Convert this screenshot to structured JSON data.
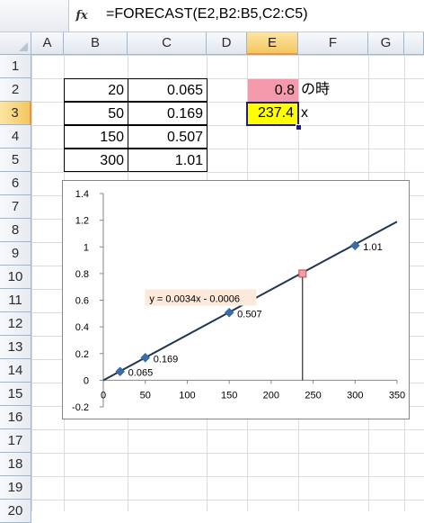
{
  "formula_bar": {
    "fx_label": "fx",
    "formula": "=FORECAST(E2,B2:B5,C2:C5)"
  },
  "grid": {
    "columns": [
      "A",
      "B",
      "C",
      "D",
      "E",
      "F",
      "G"
    ],
    "active_column": "E",
    "rows": [
      "1",
      "2",
      "3",
      "4",
      "5",
      "6",
      "7",
      "8",
      "9",
      "10",
      "11",
      "12",
      "13",
      "14",
      "15",
      "16",
      "17",
      "18",
      "19",
      "20"
    ],
    "active_row": "3"
  },
  "cells": {
    "B2": "20",
    "C2": "0.065",
    "B3": "50",
    "C3": "0.169",
    "B4": "150",
    "C4": "0.507",
    "B5": "300",
    "C5": "1.01",
    "E2": "0.8",
    "F2": "の時",
    "E3": "237.4",
    "F3": "x"
  },
  "colors": {
    "e2_fill": "#f49aac",
    "e3_fill": "#ffff00",
    "series_marker": "#3b6ea8",
    "trendline": "#1f3550",
    "forecast_marker": "#f49aac",
    "equation_box": "#fde9d9"
  },
  "chart_data": {
    "type": "scatter",
    "x": [
      20,
      50,
      150,
      300
    ],
    "y": [
      0.065,
      0.169,
      0.507,
      1.01
    ],
    "data_labels": [
      "0.065",
      "0.169",
      "0.507",
      "1.01"
    ],
    "trendline": {
      "type": "linear",
      "slope": 0.0034,
      "intercept": -0.0006,
      "equation": "y = 0.0034x - 0.0006"
    },
    "forecast_point": {
      "x": 237.4,
      "y": 0.8
    },
    "xlim": [
      0,
      350
    ],
    "ylim": [
      -0.2,
      1.4
    ],
    "x_ticks": [
      "0",
      "50",
      "100",
      "150",
      "200",
      "250",
      "300",
      "350"
    ],
    "y_ticks": [
      "-0.2",
      "0",
      "0.2",
      "0.4",
      "0.6",
      "0.8",
      "1",
      "1.2",
      "1.4"
    ],
    "grid": false,
    "legend": "none"
  }
}
